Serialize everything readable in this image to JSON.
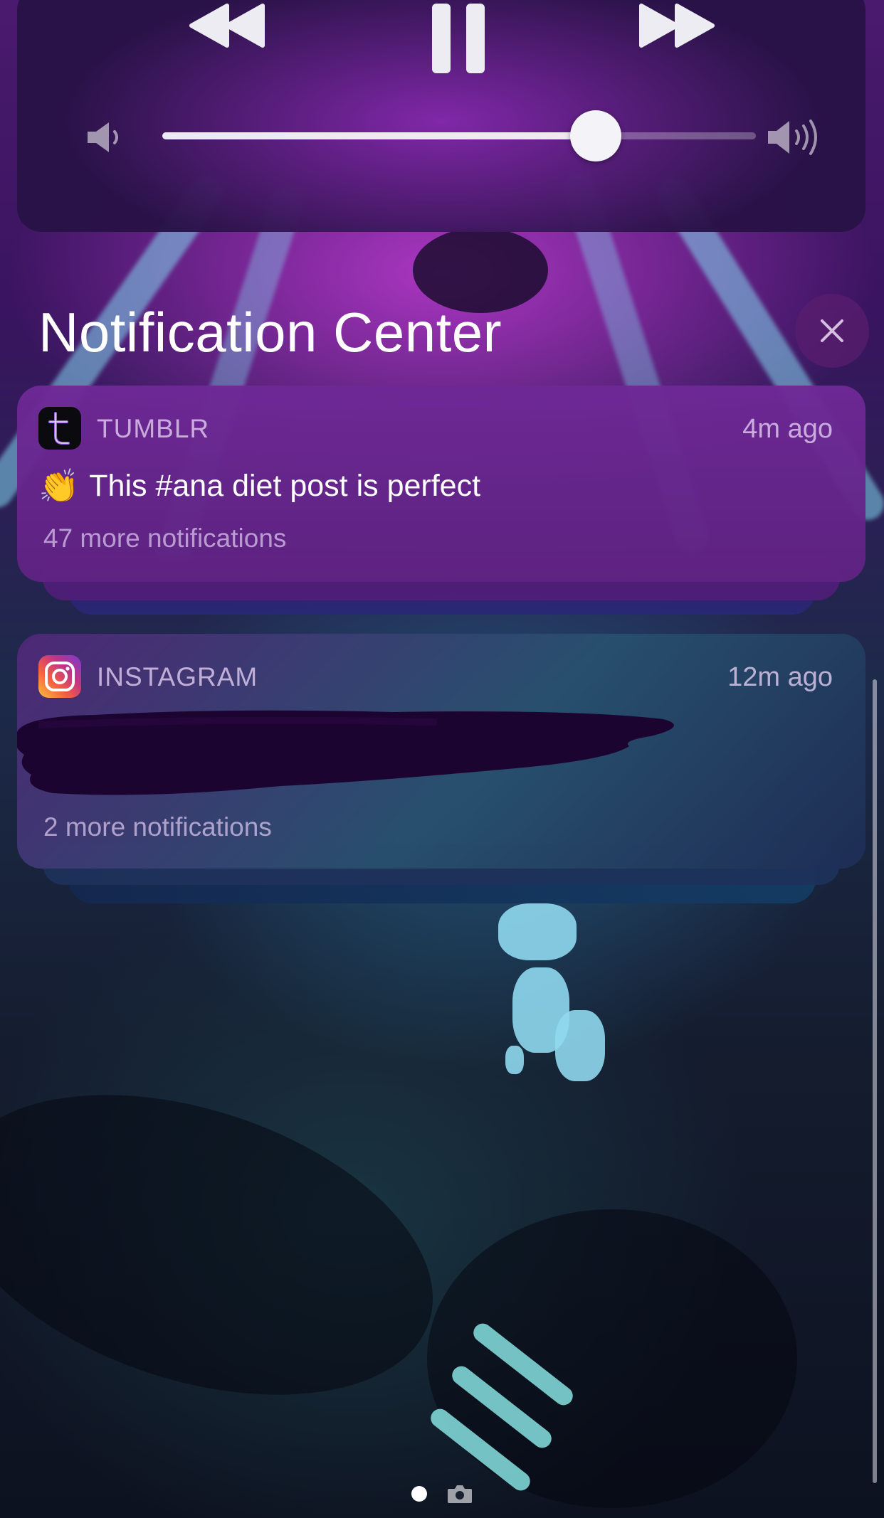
{
  "media_controls": {
    "volume_level": 0.73,
    "icons": [
      "rewind-icon",
      "pause-icon",
      "fast-forward-icon",
      "volume-low-icon",
      "volume-high-icon"
    ]
  },
  "notification_center": {
    "title": "Notification Center",
    "close_icon": "close-icon"
  },
  "notifications": [
    {
      "app": "TUMBLR",
      "time": "4m ago",
      "emoji": "👏",
      "body": "This #ana diet post is perfect",
      "more": "47 more notifications"
    },
    {
      "app": "INSTAGRAM",
      "time": "12m ago",
      "more": "2 more notifications"
    }
  ],
  "page_indicator": {
    "icons": [
      "page-dot-icon",
      "camera-icon"
    ]
  },
  "colors": {
    "panel_purple": "#5a1e7a",
    "redaction": "#1c0430",
    "tumblr_icon_bg": "#0b0b0f",
    "tumblr_icon_fg": "#9b5de5"
  }
}
